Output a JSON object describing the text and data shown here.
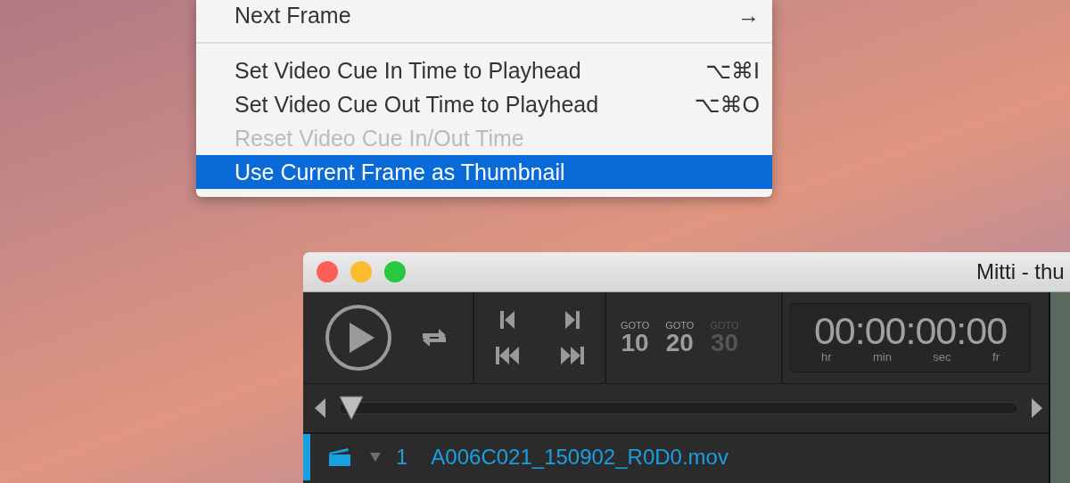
{
  "menu": {
    "items": [
      {
        "kind": "item",
        "label": "Next Frame",
        "shortcut": "→",
        "disabled": false,
        "selected": false
      },
      {
        "kind": "separator"
      },
      {
        "kind": "item",
        "label": "Set Video Cue In Time to Playhead",
        "shortcut": "⌥⌘I",
        "disabled": false,
        "selected": false
      },
      {
        "kind": "item",
        "label": "Set Video Cue Out Time to Playhead",
        "shortcut": "⌥⌘O",
        "disabled": false,
        "selected": false
      },
      {
        "kind": "item",
        "label": "Reset Video Cue In/Out Time",
        "disabled": true,
        "selected": false
      },
      {
        "kind": "item",
        "label": "Use Current Frame as Thumbnail",
        "disabled": false,
        "selected": true
      }
    ]
  },
  "window": {
    "title": "Mitti - thu",
    "goto": [
      {
        "caption": "GOTO",
        "number": "10",
        "disabled": false
      },
      {
        "caption": "GOTO",
        "number": "20",
        "disabled": false
      },
      {
        "caption": "GOTO",
        "number": "30",
        "disabled": true
      }
    ],
    "timecode": {
      "value": "00:00:00:00",
      "units": [
        "hr",
        "min",
        "sec",
        "fr"
      ]
    },
    "scrubber": {
      "level": 0.0
    },
    "cues": [
      {
        "number": "1",
        "name": "A006C021_150902_R0D0.mov",
        "selected": true
      }
    ]
  }
}
